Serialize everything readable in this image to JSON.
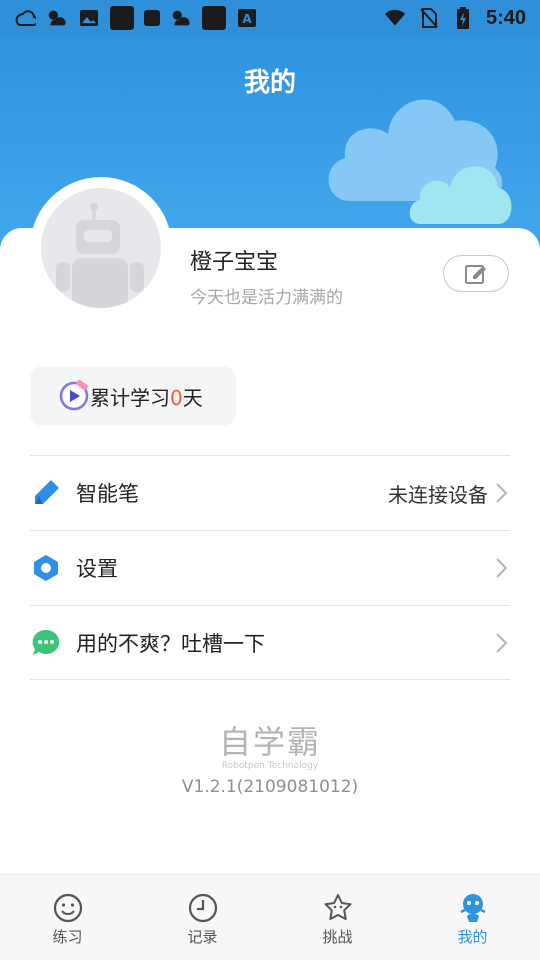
{
  "status_bar": {
    "time": "5:40",
    "icons": [
      "cast-icon",
      "weather-icon",
      "image-icon",
      "app-icon",
      "app-icon",
      "weather-icon",
      "app-icon",
      "a-icon"
    ],
    "right_icons": [
      "wifi-icon",
      "no-sim-icon",
      "battery-icon"
    ]
  },
  "header": {
    "title": "我的"
  },
  "profile": {
    "name": "橙子宝宝",
    "motto": "今天也是活力满满的",
    "edit_icon": "edit-icon"
  },
  "study": {
    "prefix": "累计学习",
    "count": "0",
    "suffix": "天"
  },
  "menu": [
    {
      "label": "智能笔",
      "value": "未连接设备",
      "icon": "pen-icon"
    },
    {
      "label": "设置",
      "value": "",
      "icon": "settings-icon"
    },
    {
      "label": "用的不爽？吐槽一下",
      "value": "",
      "icon": "chat-icon"
    }
  ],
  "brand": {
    "name": "自学霸",
    "sub": "Robotpen Technology",
    "version": "V1.2.1(2109081012)"
  },
  "bottom_nav": [
    {
      "label": "练习",
      "icon": "smile-icon",
      "active": false
    },
    {
      "label": "记录",
      "icon": "clock-icon",
      "active": false
    },
    {
      "label": "挑战",
      "icon": "star-icon",
      "active": false
    },
    {
      "label": "我的",
      "icon": "robot-icon",
      "active": true
    }
  ],
  "colors": {
    "primary": "#2f93e0",
    "accent_count": "#ff5a36"
  }
}
